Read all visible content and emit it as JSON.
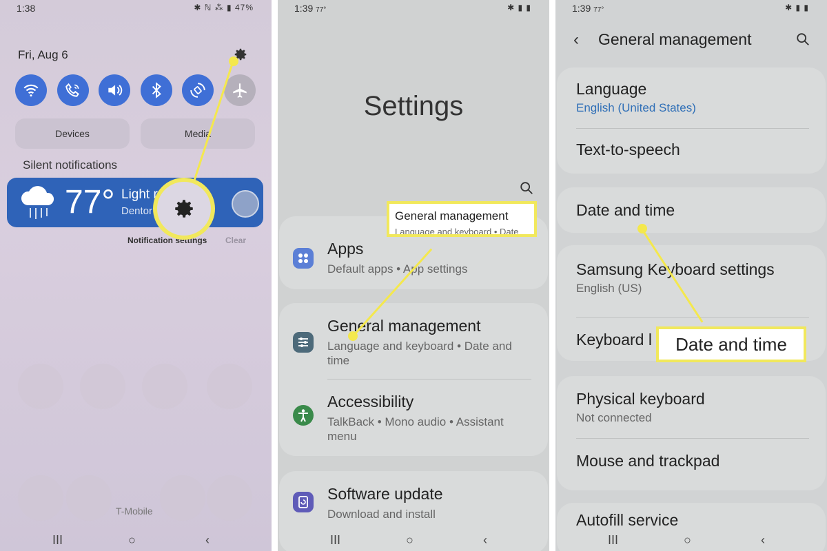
{
  "panel1": {
    "status": {
      "time": "1:38",
      "right": "✱ ℕ ⁂ ▮ 47%"
    },
    "date": "Fri, Aug 6",
    "devices_label": "Devices",
    "media_label": "Media",
    "silent_notifications": "Silent notifications",
    "weather": {
      "temp": "77°",
      "condition": "Light r",
      "location": "Dentor"
    },
    "notification_settings": "Notification settings",
    "clear": "Clear",
    "carrier": "T-Mobile"
  },
  "panel2": {
    "status": {
      "time": "1:39",
      "temp": "77°",
      "right": "✱ ▮ ▮"
    },
    "title": "Settings",
    "callout": {
      "title": "General management",
      "sub": "Language and keyboard  •  Date"
    },
    "items": [
      {
        "title": "Apps",
        "sub": "Default apps  •  App settings"
      },
      {
        "title": "General management",
        "sub": "Language and keyboard  •  Date and time"
      },
      {
        "title": "Accessibility",
        "sub": "TalkBack  •  Mono audio  •  Assistant menu"
      },
      {
        "title": "Software update",
        "sub": "Download and install"
      }
    ]
  },
  "panel3": {
    "status": {
      "time": "1:39",
      "temp": "77°",
      "right": "✱ ▮ ▮"
    },
    "header_title": "General management",
    "back_icon": "‹",
    "rows": [
      {
        "title": "Language",
        "sub": "English (United States)"
      },
      {
        "title": "Text-to-speech"
      },
      {
        "title": "Date and time"
      },
      {
        "title": "Samsung Keyboard settings",
        "sub": "English (US)"
      },
      {
        "title": "Keyboard l"
      },
      {
        "title": "Physical keyboard",
        "sub": "Not connected"
      },
      {
        "title": "Mouse and trackpad"
      },
      {
        "title": "Autofill service"
      }
    ],
    "callout": "Date and time"
  },
  "nav": {
    "recents": "III",
    "home": "○",
    "back": "‹"
  },
  "colors": {
    "highlight": "#f4e84d",
    "qs_blue": "#3f6fd6",
    "weather_blue": "#2f63b8"
  },
  "icons": [
    "gear-icon",
    "wifi-icon",
    "wifi-call-icon",
    "volume-icon",
    "bluetooth-icon",
    "rotate-icon",
    "airplane-icon",
    "search-icon",
    "apps-icon",
    "sliders-icon",
    "accessibility-icon",
    "update-icon"
  ]
}
